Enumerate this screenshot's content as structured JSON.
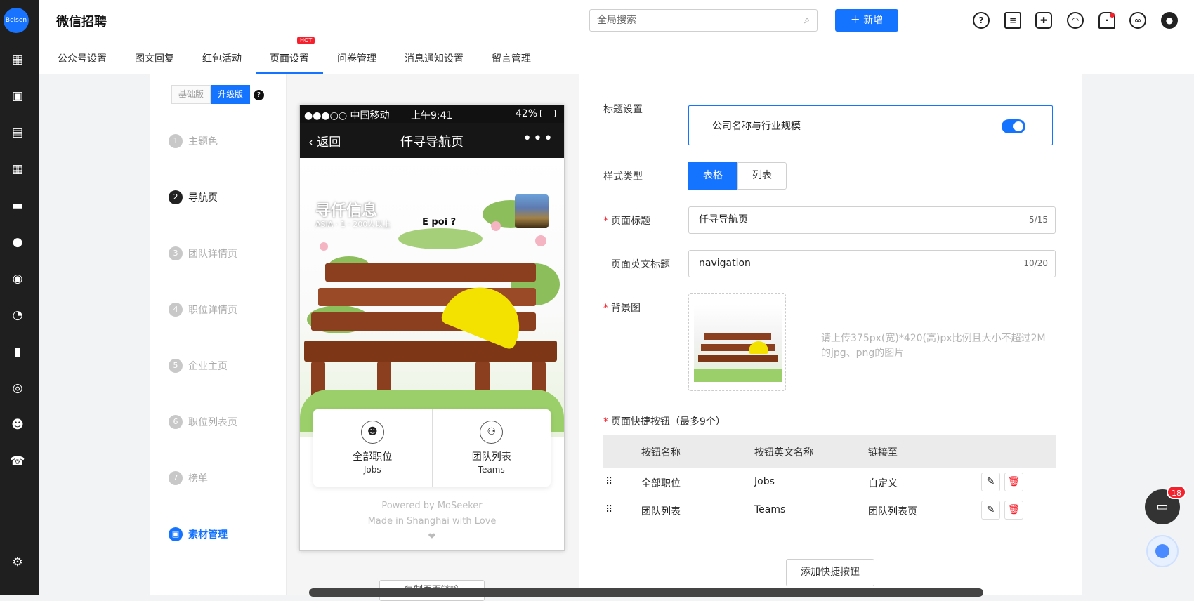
{
  "app": {
    "title": "微信招聘",
    "logo_text": "Beisen"
  },
  "rail_icons": [
    "dashboard-icon",
    "briefcase-icon",
    "resume-icon",
    "calendar-icon",
    "id-card-icon",
    "wechat-icon",
    "thumb-icon",
    "pie-chart-icon",
    "bar-chart-icon",
    "person-circle-icon",
    "group-icon",
    "phone-icon",
    "settings-icon"
  ],
  "search": {
    "placeholder": "全局搜索"
  },
  "new_button": "新增",
  "tabs": [
    {
      "label": "公众号设置"
    },
    {
      "label": "图文回复"
    },
    {
      "label": "红包活动"
    },
    {
      "label": "页面设置",
      "active": true,
      "badge": "HOT"
    },
    {
      "label": "问卷管理"
    },
    {
      "label": "消息通知设置"
    },
    {
      "label": "留言管理"
    }
  ],
  "version": {
    "basic": "基础版",
    "upgrade": "升级版"
  },
  "steps": [
    {
      "num": "1",
      "label": "主题色"
    },
    {
      "num": "2",
      "label": "导航页"
    },
    {
      "num": "3",
      "label": "团队详情页"
    },
    {
      "num": "4",
      "label": "职位详情页"
    },
    {
      "num": "5",
      "label": "企业主页"
    },
    {
      "num": "6",
      "label": "职位列表页"
    },
    {
      "num": "7",
      "label": "榜单"
    },
    {
      "num": "",
      "label": "素材管理"
    }
  ],
  "phone": {
    "carrier": "●●●○○ 中国移动",
    "time": "上午9:41",
    "battery": "42%",
    "back": "返回",
    "title": "仟寻导航页",
    "more": "•••",
    "scene_title": "寻仟信息",
    "scene_subtitle": "ASIA · 1 · 200人以上",
    "scene_text": "E poi ?",
    "quick": [
      {
        "name": "全部职位",
        "en": "Jobs"
      },
      {
        "name": "团队列表",
        "en": "Teams"
      }
    ],
    "powered_by": "Powered by MoSeeker",
    "made_in": "Made in Shanghai with Love",
    "heart": "❤"
  },
  "copy_link": "复制页面链接",
  "form": {
    "title_setting_label": "标题设置",
    "title_setting_value": "公司名称与行业规模",
    "style_label": "样式类型",
    "style_options": [
      "表格",
      "列表"
    ],
    "page_title_label": "页面标题",
    "page_title_value": "仟寻导航页",
    "page_title_count": "5/15",
    "page_en_title_label": "页面英文标题",
    "page_en_title_value": "navigation",
    "page_en_title_count": "10/20",
    "bg_label": "背景图",
    "bg_hint": "请上传375px(宽)*420(高)px比例且大小不超过2M的jpg、png的图片",
    "shortcut_label": "页面快捷按钮（最多9个）",
    "table_headers": [
      "按钮名称",
      "按钮英文名称",
      "链接至"
    ],
    "table_rows": [
      {
        "name": "全部职位",
        "en": "Jobs",
        "link": "自定义"
      },
      {
        "name": "团队列表",
        "en": "Teams",
        "link": "团队列表页"
      }
    ],
    "add_button": "添加快捷按钮"
  },
  "chat_badge": "18",
  "accent": "#1473ff"
}
